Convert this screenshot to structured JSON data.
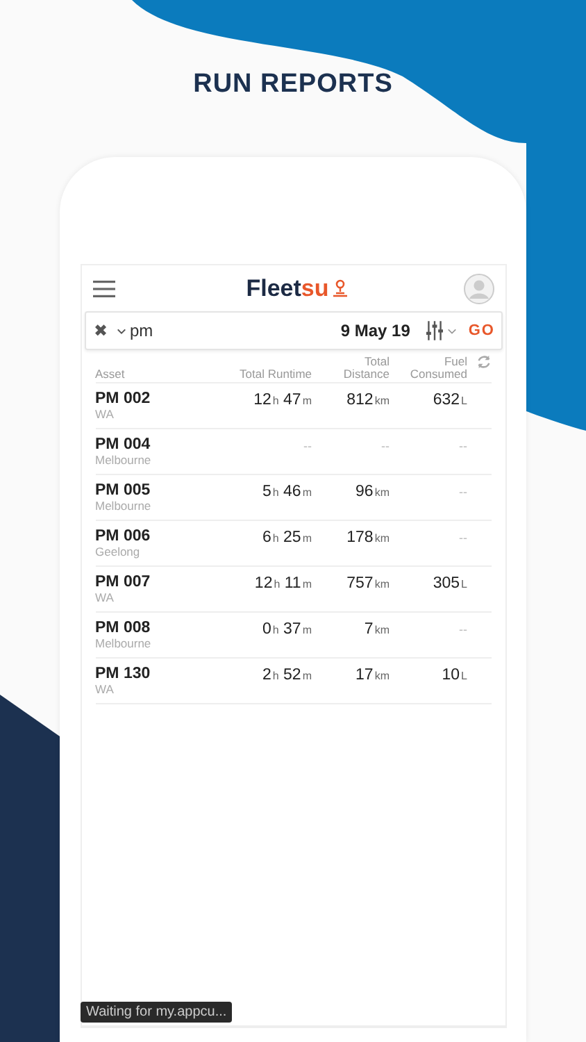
{
  "headline": "RUN REPORTS",
  "app": {
    "logo": {
      "main": "Fleet",
      "accent": "su"
    },
    "filter": {
      "clear_icon": "✖",
      "search_value": "pm",
      "date": "9 May 19",
      "go": "GO"
    },
    "table": {
      "columns": [
        {
          "kind": "left",
          "label": "Asset"
        },
        {
          "kind": "right",
          "label": "Total Runtime"
        },
        {
          "kind": "right",
          "label": "Total Distance"
        },
        {
          "kind": "right",
          "label": "Fuel Consumed"
        }
      ],
      "rows": [
        {
          "asset": "PM 002",
          "location": "WA",
          "runtime": [
            {
              "value": "12",
              "unit": "h"
            },
            {
              "value": "47",
              "unit": "m"
            }
          ],
          "distance": [
            {
              "value": "812",
              "unit": "km"
            }
          ],
          "fuel": [
            {
              "value": "632",
              "unit": "L"
            }
          ]
        },
        {
          "asset": "PM 004",
          "location": "Melbourne",
          "runtime": [
            {
              "value": "--"
            }
          ],
          "distance": [
            {
              "value": "--"
            }
          ],
          "fuel": [
            {
              "value": "--"
            }
          ]
        },
        {
          "asset": "PM 005",
          "location": "Melbourne",
          "runtime": [
            {
              "value": "5",
              "unit": "h"
            },
            {
              "value": "46",
              "unit": "m"
            }
          ],
          "distance": [
            {
              "value": "96",
              "unit": "km"
            }
          ],
          "fuel": [
            {
              "value": "--"
            }
          ]
        },
        {
          "asset": "PM 006",
          "location": "Geelong",
          "runtime": [
            {
              "value": "6",
              "unit": "h"
            },
            {
              "value": "25",
              "unit": "m"
            }
          ],
          "distance": [
            {
              "value": "178",
              "unit": "km"
            }
          ],
          "fuel": [
            {
              "value": "--"
            }
          ]
        },
        {
          "asset": "PM 007",
          "location": "WA",
          "runtime": [
            {
              "value": "12",
              "unit": "h"
            },
            {
              "value": "11",
              "unit": "m"
            }
          ],
          "distance": [
            {
              "value": "757",
              "unit": "km"
            }
          ],
          "fuel": [
            {
              "value": "305",
              "unit": "L"
            }
          ]
        },
        {
          "asset": "PM 008",
          "location": "Melbourne",
          "runtime": [
            {
              "value": "0",
              "unit": "h"
            },
            {
              "value": "37",
              "unit": "m"
            }
          ],
          "distance": [
            {
              "value": "7",
              "unit": "km"
            }
          ],
          "fuel": [
            {
              "value": "--"
            }
          ]
        },
        {
          "asset": "PM 130",
          "location": "WA",
          "runtime": [
            {
              "value": "2",
              "unit": "h"
            },
            {
              "value": "52",
              "unit": "m"
            }
          ],
          "distance": [
            {
              "value": "17",
              "unit": "km"
            }
          ],
          "fuel": [
            {
              "value": "10",
              "unit": "L"
            }
          ]
        }
      ]
    }
  },
  "status_tooltip": "Waiting for my.appcu..."
}
